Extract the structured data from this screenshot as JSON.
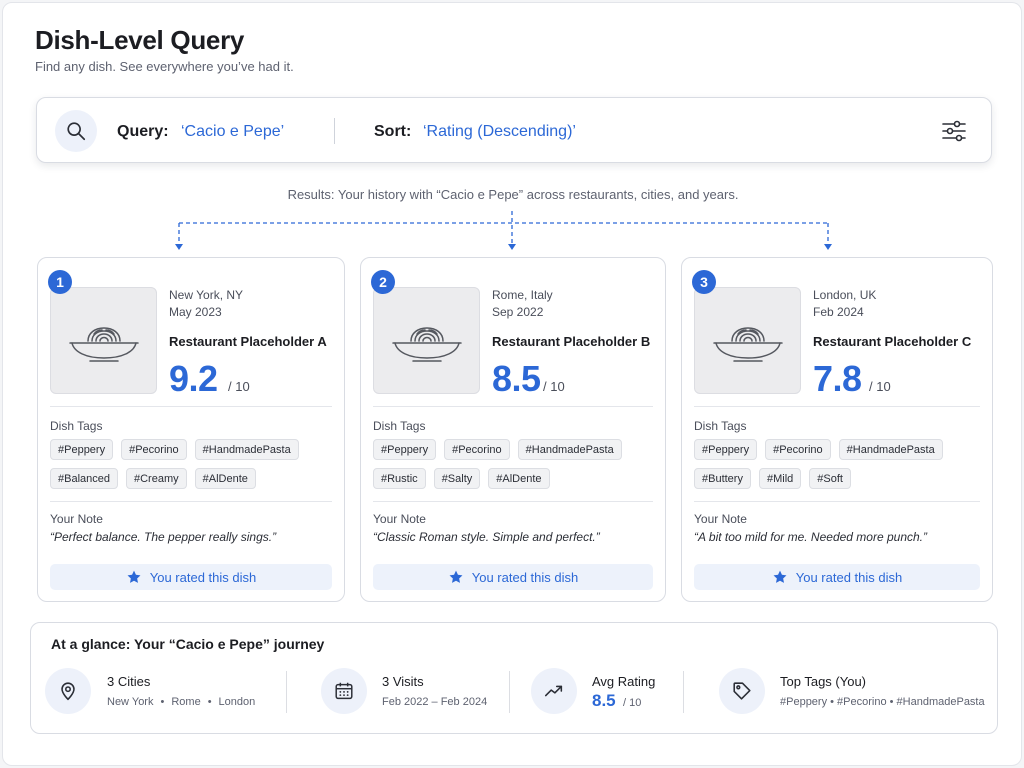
{
  "header": {
    "title": "Dish-Level Query",
    "subtitle": "Find any dish. See everywhere you’ve had it."
  },
  "search": {
    "query_label": "Query:",
    "query_value": "‘Cacio e Pepe’",
    "sort_label": "Sort:",
    "sort_value": "‘Rating (Descending)’"
  },
  "results_caption": "Results: Your history with “Cacio e Pepe” across restaurants, cities, and years.",
  "cards": [
    {
      "rank": "1",
      "location": "New York, NY",
      "date": "May 2023",
      "restaurant": "Restaurant Placeholder A",
      "score": "9.2",
      "out_of": "/ 10",
      "tags_label": "Dish Tags",
      "tags": [
        "#Peppery",
        "#Pecorino",
        "#HandmadePasta",
        "#Balanced",
        "#Creamy",
        "#AlDente"
      ],
      "note_label": "Your Note",
      "note": "“Perfect balance. The pepper really sings.”",
      "rated_label": "You rated this dish"
    },
    {
      "rank": "2",
      "location": "Rome, Italy",
      "date": "Sep 2022",
      "restaurant": "Restaurant Placeholder B",
      "score": "8.5",
      "out_of": "/ 10",
      "tags_label": "Dish Tags",
      "tags": [
        "#Peppery",
        "#Pecorino",
        "#HandmadePasta",
        "#Rustic",
        "#Salty",
        "#AlDente"
      ],
      "note_label": "Your Note",
      "note": "“Classic Roman style. Simple and perfect.”",
      "rated_label": "You rated this dish"
    },
    {
      "rank": "3",
      "location": "London, UK",
      "date": "Feb 2024",
      "restaurant": "Restaurant Placeholder C",
      "score": "7.8",
      "out_of": "/ 10",
      "tags_label": "Dish Tags",
      "tags": [
        "#Peppery",
        "#Pecorino",
        "#HandmadePasta",
        "#Buttery",
        "#Mild",
        "#Soft"
      ],
      "note_label": "Your Note",
      "note": "“A bit too mild for me. Needed more punch.”",
      "rated_label": "You rated this dish"
    }
  ],
  "glance": {
    "title": "At a glance: Your “Cacio e Pepe” journey",
    "cities": {
      "main": "3 Cities",
      "list": [
        "New York",
        "Rome",
        "London"
      ]
    },
    "visits": {
      "main": "3 Visits",
      "range": "Feb 2022 – Feb 2024"
    },
    "rating": {
      "label": "Avg Rating",
      "value": "8.5",
      "out_of": "/ 10"
    },
    "tags": {
      "label": "Top Tags (You)",
      "value": "#Peppery • #Pecorino • #HandmadePasta"
    }
  },
  "icons": {
    "search": "search-icon",
    "filter": "sliders-icon",
    "dish": "pasta-bowl-icon",
    "star": "star-icon",
    "location": "map-pin-icon",
    "calendar": "calendar-icon",
    "trend": "trend-up-icon",
    "tag": "tag-icon"
  },
  "colors": {
    "accent": "#2c68d6",
    "accent_soft": "#edf2fb"
  }
}
